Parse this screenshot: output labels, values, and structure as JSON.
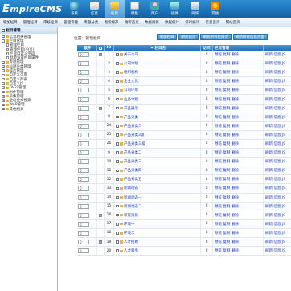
{
  "header": {
    "logo_main": "mpireCMS",
    "logo_initial": "E",
    "nav": [
      {
        "label": "系统",
        "icon": "system-icon"
      },
      {
        "label": "信息",
        "icon": "info-icon"
      },
      {
        "label": "栏目",
        "icon": "column-icon",
        "active": true
      },
      {
        "label": "模板",
        "icon": "template-icon"
      },
      {
        "label": "用户",
        "icon": "user-icon"
      },
      {
        "label": "插件",
        "icon": "plugin-icon"
      },
      {
        "label": "商城",
        "icon": "mall-icon"
      },
      {
        "label": "其他",
        "icon": "other-icon"
      }
    ]
  },
  "menubar": [
    "增加栏目",
    "管理栏目",
    "审核栏目",
    "管理专题",
    "专题分类",
    "更新缓存",
    "更新首页",
    "数据更新",
    "数据统计",
    "排行统计",
    "信息首页",
    "网站首页"
  ],
  "sidebar": {
    "title": "栏目管理",
    "items": [
      {
        "label": "信息相关管理",
        "level": 0,
        "type": "pm",
        "sign": "+"
      },
      {
        "label": "栏目管理",
        "level": 0,
        "type": "pm",
        "sign": "-"
      },
      {
        "label": "管理栏目",
        "level": 1,
        "type": "doc"
      },
      {
        "label": "管理栏目(分页)",
        "level": 1,
        "type": "doc"
      },
      {
        "label": "栏目自定义字段",
        "level": 1,
        "type": "doc"
      },
      {
        "label": "批量设置栏目属性",
        "level": 1,
        "type": "doc"
      },
      {
        "label": "专题管理",
        "level": 0,
        "type": "pm",
        "sign": "+"
      },
      {
        "label": "标题分类管理",
        "level": 0,
        "type": "pm",
        "sign": "+"
      },
      {
        "label": "碎片管理",
        "level": 0,
        "type": "pm",
        "sign": "+"
      },
      {
        "label": "自定义页面",
        "level": 0,
        "type": "pm",
        "sign": "+"
      },
      {
        "label": "自定义列表",
        "level": 0,
        "type": "pm",
        "sign": "+"
      },
      {
        "label": "自定义JS",
        "level": 0,
        "type": "pm",
        "sign": "+"
      },
      {
        "label": "TAGS管理",
        "level": 0,
        "type": "pm",
        "sign": "+"
      },
      {
        "label": "附件管理",
        "level": 0,
        "type": "pm",
        "sign": "+"
      },
      {
        "label": "采集管理",
        "level": 0,
        "type": "pm",
        "sign": "+"
      },
      {
        "label": "全站全文搜索",
        "level": 0,
        "type": "pm",
        "sign": "+"
      },
      {
        "label": "WAP管理",
        "level": 0,
        "type": "pm",
        "sign": "+"
      },
      {
        "label": "其他相关",
        "level": 0,
        "type": "pm",
        "sign": "+"
      }
    ]
  },
  "main": {
    "breadcrumb": "位置：管理栏目",
    "buttons": [
      "增加栏目",
      "刷新首页",
      "刷新所有栏目页",
      "刷新所有信息页面"
    ],
    "columns": {
      "order": "顺序",
      "id": "ID",
      "name": "栏目名",
      "visits": "访问",
      "ops": "栏目管理"
    },
    "rows": [
      {
        "order": "0",
        "fold": "+",
        "id": "1",
        "name": "关于公司",
        "visits": "0",
        "ops": "预览 复制 删除",
        "ext": "刷新 信息 JS"
      },
      {
        "order": "0",
        "fold": "",
        "id": "2",
        "name": "公司介绍",
        "visits": "0",
        "ops": "预览 复制 删除",
        "ext": "刷新 信息 JS"
      },
      {
        "order": "0",
        "fold": "",
        "id": "3",
        "name": "组织机构",
        "visits": "0",
        "ops": "预览 复制 删除",
        "ext": "刷新 信息 JS"
      },
      {
        "order": "0",
        "fold": "",
        "id": "4",
        "name": "企业文化",
        "visits": "0",
        "ops": "预览 复制 删除",
        "ext": "刷新 信息 JS"
      },
      {
        "order": "0",
        "fold": "",
        "id": "5",
        "name": "公司环境",
        "visits": "0",
        "ops": "预览 复制 删除",
        "ext": "刷新 信息 JS"
      },
      {
        "order": "0",
        "fold": "",
        "id": "6",
        "name": "业务介绍",
        "visits": "0",
        "ops": "预览 复制 删除",
        "ext": "刷新 信息 JS"
      },
      {
        "order": "0",
        "fold": "+",
        "id": "7",
        "name": "产品展示",
        "visits": "0",
        "ops": "预览 复制 删除",
        "ext": "刷新 信息 JS"
      },
      {
        "order": "0",
        "fold": "",
        "id": "8",
        "name": "产品分类一",
        "visits": "0",
        "ops": "预览 复制 删除",
        "ext": "刷新 信息 JS"
      },
      {
        "order": "0",
        "fold": "",
        "id": "24",
        "name": "产品分类二",
        "visits": "0",
        "ops": "预览 复制 删除",
        "ext": "刷新 信息 JS"
      },
      {
        "order": "0",
        "fold": "",
        "id": "25",
        "name": "产品分类3级",
        "visits": "0",
        "ops": "预览 复制 删除",
        "ext": "刷新 信息 JS"
      },
      {
        "order": "0",
        "fold": "",
        "id": "26",
        "name": "产品分类三级",
        "visits": "0",
        "ops": "预览 复制 删除",
        "ext": "刷新 信息 JS"
      },
      {
        "order": "0",
        "fold": "",
        "id": "9",
        "name": "产品分类二",
        "visits": "0",
        "ops": "预览 复制 删除",
        "ext": "刷新 信息 JS"
      },
      {
        "order": "0",
        "fold": "",
        "id": "10",
        "name": "产品分类三",
        "visits": "0",
        "ops": "预览 复制 删除",
        "ext": "刷新 信息 JS"
      },
      {
        "order": "0",
        "fold": "",
        "id": "11",
        "name": "产品分类四",
        "visits": "0",
        "ops": "预览 复制 删除",
        "ext": "刷新 信息 JS"
      },
      {
        "order": "0",
        "fold": "",
        "id": "12",
        "name": "产品分类五",
        "visits": "0",
        "ops": "预览 复制 删除",
        "ext": "刷新 信息 JS"
      },
      {
        "order": "0",
        "fold": "",
        "id": "13",
        "name": "新闻动态",
        "visits": "0",
        "ops": "预览 复制 删除",
        "ext": "刷新 信息 JS"
      },
      {
        "order": "0",
        "fold": "",
        "id": "14",
        "name": "新闻动态一",
        "visits": "0",
        "ops": "预览 复制 删除",
        "ext": "刷新 信息 JS"
      },
      {
        "order": "0",
        "fold": "",
        "id": "15",
        "name": "新闻动态二",
        "visits": "0",
        "ops": "预览 复制 删除",
        "ext": "刷新 信息 JS"
      },
      {
        "order": "0",
        "fold": "+",
        "id": "16",
        "name": "荣誉资质",
        "visits": "0",
        "ops": "预览 复制 删除",
        "ext": "刷新 信息 JS"
      },
      {
        "order": "0",
        "fold": "",
        "id": "17",
        "name": "环境一",
        "visits": "0",
        "ops": "预览 复制 删除",
        "ext": "刷新 信息 JS"
      },
      {
        "order": "0",
        "fold": "",
        "id": "18",
        "name": "环境二",
        "visits": "0",
        "ops": "预览 复制 删除",
        "ext": "刷新 信息 JS"
      },
      {
        "order": "0",
        "fold": "+",
        "id": "19",
        "name": "人才招聘",
        "visits": "0",
        "ops": "预览 复制 删除",
        "ext": "刷新 信息 JS"
      },
      {
        "order": "0",
        "fold": "",
        "id": "20",
        "name": "人才服务",
        "visits": "0",
        "ops": "预览 复制 删除",
        "ext": "刷新 信息 JS"
      }
    ]
  },
  "colors": {
    "accent": "#236fb4",
    "link": "#1133cc",
    "folder": "#e9b33a"
  }
}
